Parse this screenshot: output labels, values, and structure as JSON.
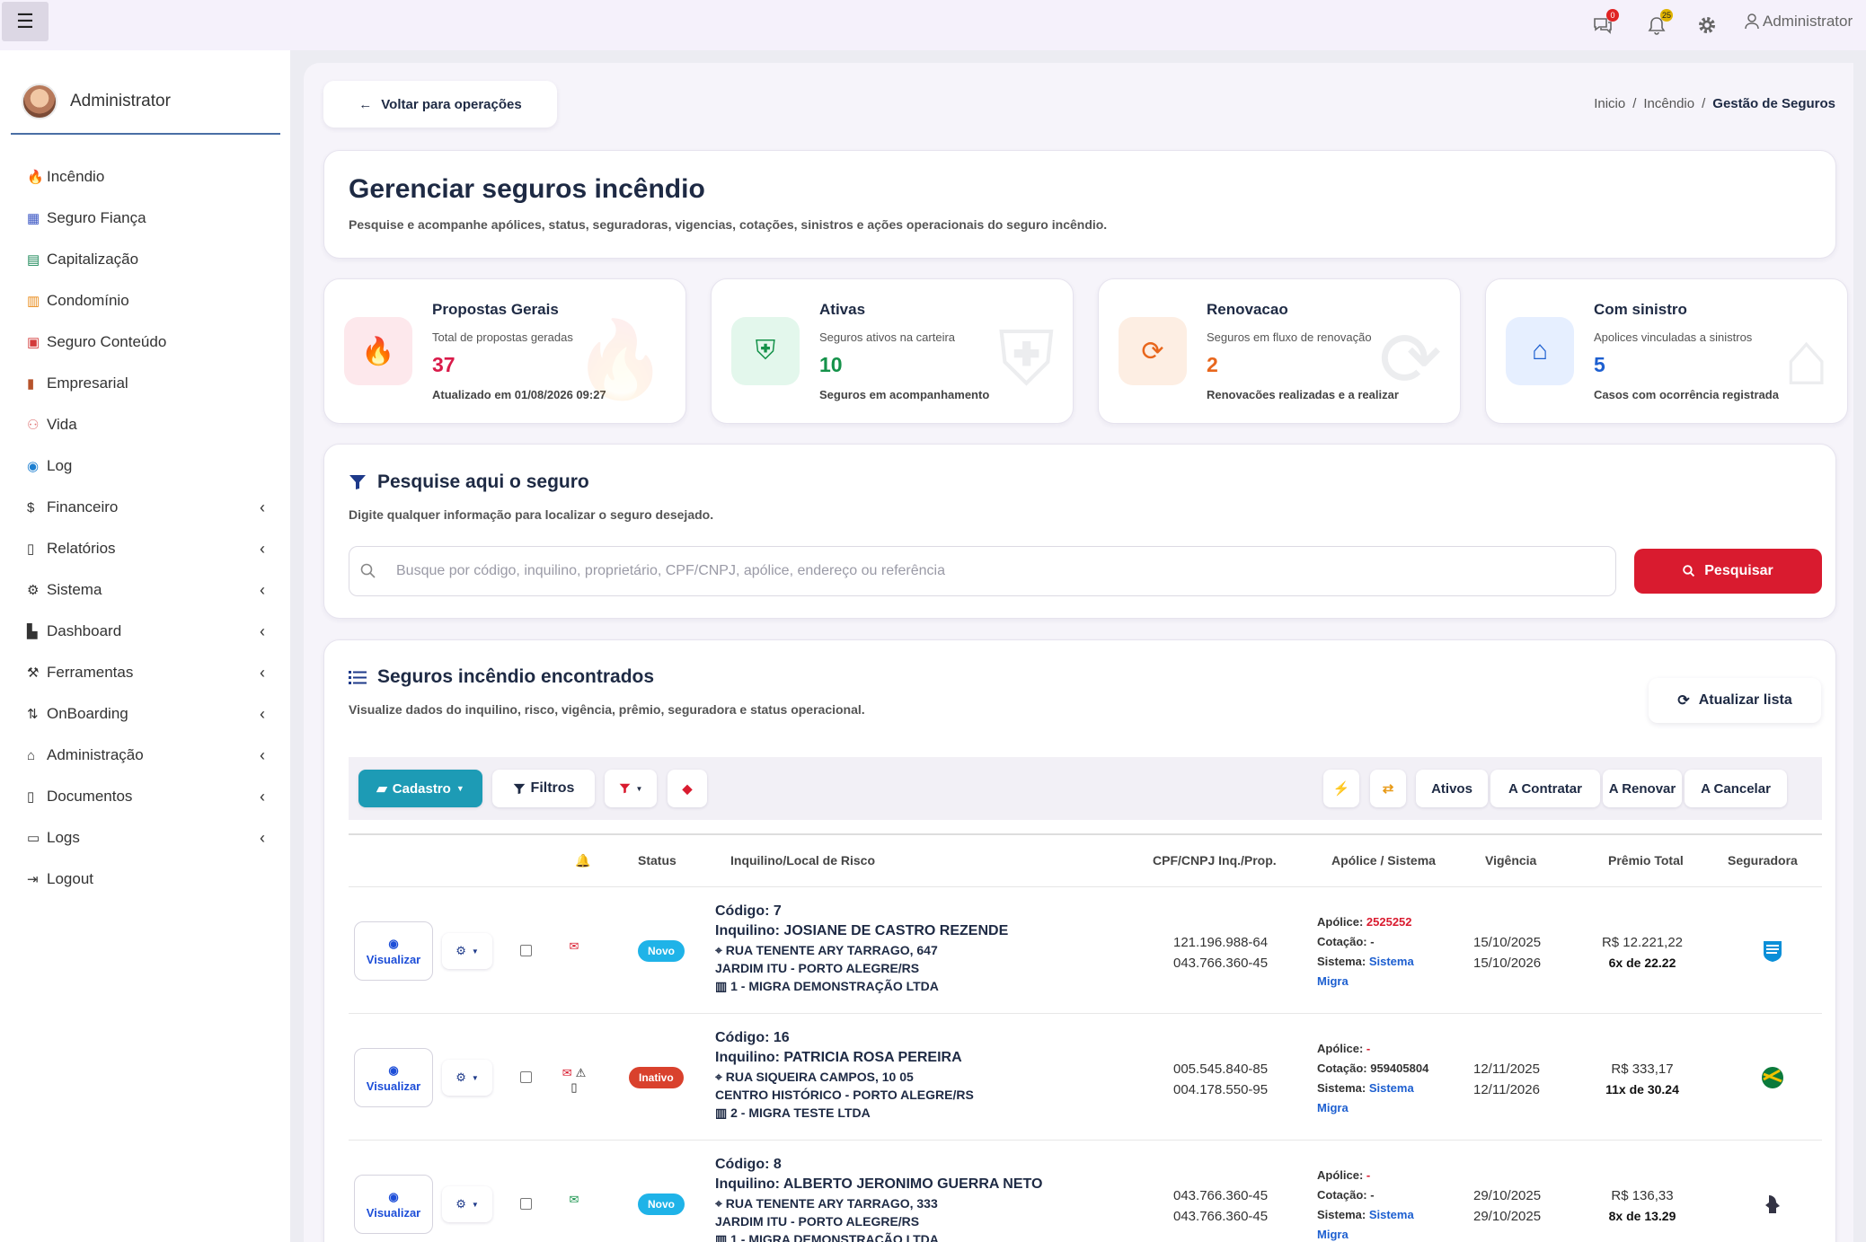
{
  "topbar": {
    "menu_icon": "hamburger-icon",
    "chat_badge": "0",
    "bell_badge": "25",
    "user": "Administrator",
    "colors": {
      "chat_badge": "#e02424",
      "bell_badge": "#e0b400"
    }
  },
  "sidebar": {
    "user_name": "Administrator",
    "items": [
      {
        "label": "Incêndio",
        "icon": "fire-icon",
        "color": "#e8432a",
        "chevron": false
      },
      {
        "label": "Seguro Fiança",
        "icon": "calendar-icon",
        "color": "#3b56c4",
        "chevron": false
      },
      {
        "label": "Capitalização",
        "icon": "table-icon",
        "color": "#1f8a5b",
        "chevron": false
      },
      {
        "label": "Condomínio",
        "icon": "building-icon",
        "color": "#e98a17",
        "chevron": false
      },
      {
        "label": "Seguro Conteúdo",
        "icon": "box-icon",
        "color": "#d33b3b",
        "chevron": false
      },
      {
        "label": "Empresarial",
        "icon": "briefcase-icon",
        "color": "#b6532b",
        "chevron": false
      },
      {
        "label": "Vida",
        "icon": "people-icon",
        "color": "#e07a7a",
        "chevron": false
      },
      {
        "label": "Log",
        "icon": "eye-icon",
        "color": "#1d7fd0",
        "chevron": false
      },
      {
        "label": "Financeiro",
        "icon": "dollar-icon",
        "color": "#333333",
        "chevron": true
      },
      {
        "label": "Relatórios",
        "icon": "pdf-icon",
        "color": "#333333",
        "chevron": true
      },
      {
        "label": "Sistema",
        "icon": "gear-icon",
        "color": "#333333",
        "chevron": true
      },
      {
        "label": "Dashboard",
        "icon": "chart-icon",
        "color": "#333333",
        "chevron": true
      },
      {
        "label": "Ferramentas",
        "icon": "wrench-icon",
        "color": "#333333",
        "chevron": true
      },
      {
        "label": "OnBoarding",
        "icon": "sort-icon",
        "color": "#333333",
        "chevron": true
      },
      {
        "label": "Administração",
        "icon": "home-icon",
        "color": "#333333",
        "chevron": true
      },
      {
        "label": "Documentos",
        "icon": "file-icon",
        "color": "#333333",
        "chevron": true
      },
      {
        "label": "Logs",
        "icon": "monitor-icon",
        "color": "#333333",
        "chevron": true
      },
      {
        "label": "Logout",
        "icon": "logout-icon",
        "color": "#333333",
        "chevron": false
      }
    ]
  },
  "nav": {
    "back_label": "Voltar para operações",
    "breadcrumb": [
      "Inicio",
      "/",
      "Incêndio",
      "/",
      "Gestão de Seguros"
    ]
  },
  "header": {
    "title": "Gerenciar seguros incêndio",
    "subtitle": "Pesquise e acompanhe apólices, status, seguradoras, vigencias, cotações, sinistros e ações operacionais do seguro incêndio."
  },
  "stats": [
    {
      "title": "Propostas Gerais",
      "sub": "Total de propostas geradas",
      "value": "37",
      "foot": "Atualizado em 01/08/2026 09:27",
      "icon": "fire-icon",
      "color": "#d91b4a",
      "bg": "#fde8ec"
    },
    {
      "title": "Ativas",
      "sub": "Seguros ativos na carteira",
      "value": "10",
      "foot": "Seguros em acompanhamento",
      "icon": "shield-icon",
      "color": "#15924a",
      "bg": "#e3f7ec"
    },
    {
      "title": "Renovacao",
      "sub": "Seguros em fluxo de renovação",
      "value": "2",
      "foot": "Renovacões realizadas e a realizar",
      "icon": "sync-icon",
      "color": "#e8661c",
      "bg": "#fdeee3"
    },
    {
      "title": "Com sinistro",
      "sub": "Apolices vinculadas a sinistros",
      "value": "5",
      "foot": "Casos com ocorrência registrada",
      "icon": "house-damage-icon",
      "color": "#1d5fd0",
      "bg": "#e6efff"
    }
  ],
  "search": {
    "title": "Pesquise aqui o seguro",
    "subtitle": "Digite qualquer informação para localizar o seguro desejado.",
    "placeholder": "Busque por código, inquilino, proprietário, CPF/CNPJ, apólice, endereço ou referência",
    "button": "Pesquisar"
  },
  "results": {
    "title": "Seguros incêndio encontrados",
    "subtitle": "Visualize dados do inquilino, risco, vigência, prêmio, seguradora e status operacional.",
    "refresh_label": "Atualizar lista",
    "toolbar": {
      "cadastro": "Cadastro",
      "filtros": "Filtros",
      "quick_filters": [
        "Ativos",
        "A Contratar",
        "A Renovar",
        "A Cancelar"
      ]
    },
    "columns": [
      "Status",
      "Inquilino/Local de Risco",
      "CPF/CNPJ Inq./Prop.",
      "Apólice / Sistema",
      "Vigência",
      "Prêmio Total",
      "Seguradora"
    ],
    "view_label": "Visualizar",
    "rows": [
      {
        "status": "Novo",
        "status_color": "#1fb3e8",
        "flags": [
          "envelope-icon"
        ],
        "codigo": "Código: 7",
        "inquilino": "Inquilino: JOSIANE DE CASTRO REZENDE",
        "endereco": "RUA TENENTE ARY TARRAGO, 647",
        "bairro": "JARDIM ITU - PORTO ALEGRE/RS",
        "imobiliaria": "1 - MIGRA DEMONSTRAÇÃO LTDA",
        "doc1": "121.196.988-64",
        "doc2": "043.766.360-45",
        "apolice": "2525252",
        "cotacao": "-",
        "sistema": "Sistema Migra",
        "vig1": "15/10/2025",
        "vig2": "15/10/2026",
        "premio": "R$ 12.221,22",
        "parcelas": "6x de 22.22",
        "seguradora_icon": "insurer-logo-blue"
      },
      {
        "status": "Inativo",
        "status_color": "#d9412d",
        "flags": [
          "envelope-icon",
          "warning-icon",
          "file-icon"
        ],
        "codigo": "Código: 16",
        "inquilino": "Inquilino: PATRICIA ROSA PEREIRA",
        "endereco": "RUA SIQUEIRA CAMPOS, 10 05",
        "bairro": "CENTRO HISTÓRICO - PORTO ALEGRE/RS",
        "imobiliaria": "2 - MIGRA TESTE LTDA",
        "doc1": "005.545.840-85",
        "doc2": "004.178.550-95",
        "apolice": "-",
        "cotacao": "959405804",
        "sistema": "Sistema Migra",
        "vig1": "12/11/2025",
        "vig2": "12/11/2026",
        "premio": "R$ 333,17",
        "parcelas": "11x de 30.24",
        "seguradora_icon": "insurer-logo-green"
      },
      {
        "status": "Novo",
        "status_color": "#1fb3e8",
        "flags": [
          "envelope-open-icon"
        ],
        "codigo": "Código: 8",
        "inquilino": "Inquilino: ALBERTO JERONIMO GUERRA NETO",
        "endereco": "RUA TENENTE ARY TARRAGO, 333",
        "bairro": "JARDIM ITU - PORTO ALEGRE/RS",
        "imobiliaria": "1 - MIGRA DEMONSTRAÇÃO LTDA",
        "doc1": "043.766.360-45",
        "doc2": "043.766.360-45",
        "apolice": "-",
        "cotacao": "-",
        "sistema": "Sistema Migra",
        "vig1": "29/10/2025",
        "vig2": "29/10/2025",
        "premio": "R$ 136,33",
        "parcelas": "8x de 13.29",
        "seguradora_icon": "insurer-logo-dark"
      }
    ]
  }
}
